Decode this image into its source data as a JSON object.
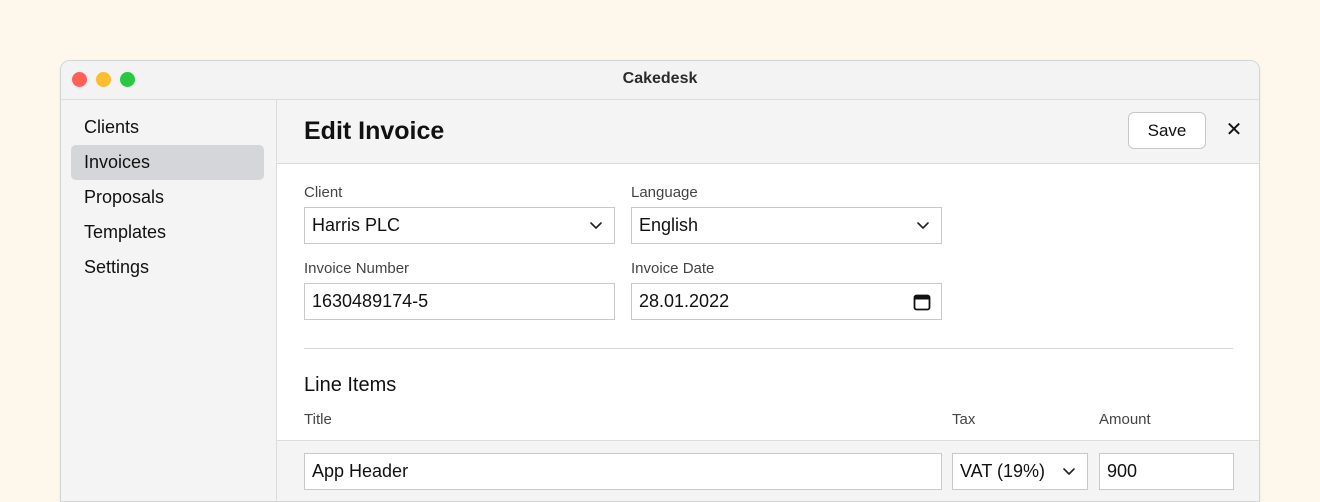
{
  "window": {
    "title": "Cakedesk"
  },
  "sidebar": {
    "items": [
      {
        "label": "Clients",
        "active": false
      },
      {
        "label": "Invoices",
        "active": true
      },
      {
        "label": "Proposals",
        "active": false
      },
      {
        "label": "Templates",
        "active": false
      },
      {
        "label": "Settings",
        "active": false
      }
    ]
  },
  "header": {
    "title": "Edit Invoice",
    "save_label": "Save",
    "close_glyph": "✕"
  },
  "form": {
    "client": {
      "label": "Client",
      "value": "Harris PLC"
    },
    "language": {
      "label": "Language",
      "value": "English"
    },
    "invoice_number": {
      "label": "Invoice Number",
      "value": "1630489174-5"
    },
    "invoice_date": {
      "label": "Invoice Date",
      "value": "28.01.2022"
    }
  },
  "line_items": {
    "title": "Line Items",
    "columns": {
      "title": "Title",
      "tax": "Tax",
      "amount": "Amount"
    },
    "rows": [
      {
        "title": "App Header",
        "tax": "VAT (19%)",
        "amount": "900"
      }
    ]
  },
  "icons": {
    "select": "chevron-down-icon",
    "date": "calendar-icon",
    "close": "close-icon"
  },
  "colors": {
    "page_background": "#fdf8eb",
    "close_dot": "#fe5f57",
    "minimize_dot": "#febc2e",
    "maximize_dot": "#28c840",
    "sidebar_active": "#d5d6d9"
  }
}
